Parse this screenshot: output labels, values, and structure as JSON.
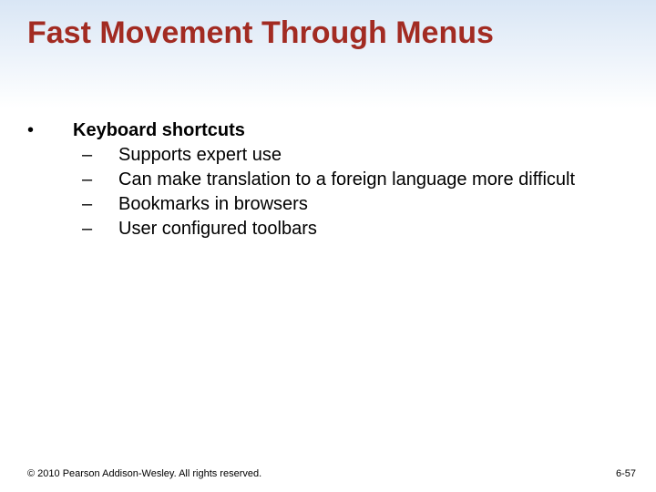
{
  "title": "Fast Movement Through Menus",
  "bullet_glyph": "•",
  "dash_glyph": "–",
  "content": {
    "heading": "Keyboard shortcuts",
    "items": [
      "Supports expert use",
      "Can make translation to a foreign language more difficult",
      "Bookmarks in browsers",
      "User configured toolbars"
    ]
  },
  "footer": {
    "copyright": "© 2010 Pearson Addison-Wesley. All rights reserved.",
    "page": "6-57"
  }
}
